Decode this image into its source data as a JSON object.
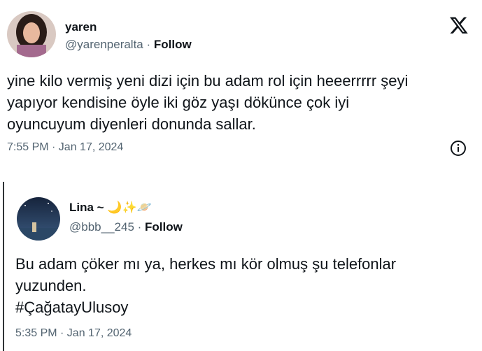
{
  "tweets": [
    {
      "name": "yaren",
      "handle": "@yarenperalta",
      "separator": " · ",
      "follow": "Follow",
      "text_lines": [
        "yine kilo vermiş yeni dizi için bu adam rol için heeerrrrr şeyi",
        "yapıyor kendisine öyle iki göz yaşı dökünce çok iyi",
        "oyuncuyum diyenleri donunda sallar."
      ],
      "timestamp": "7:55 PM · Jan 17, 2024",
      "icons": [
        "x-logo-icon",
        "info-icon"
      ]
    },
    {
      "name": "Lina ~ 🌙✨🪐",
      "handle": "@bbb__245",
      "separator": " · ",
      "follow": "Follow",
      "text_lines": [
        "Bu adam çöker mı ya, herkes mı kör olmuş şu telefonlar",
        "yuzunden.",
        "#ÇağatayUlusoy"
      ],
      "timestamp": "5:35 PM · Jan 17, 2024"
    }
  ],
  "colors": {
    "text": "#0f1419",
    "secondary": "#536471",
    "background": "#ffffff"
  }
}
